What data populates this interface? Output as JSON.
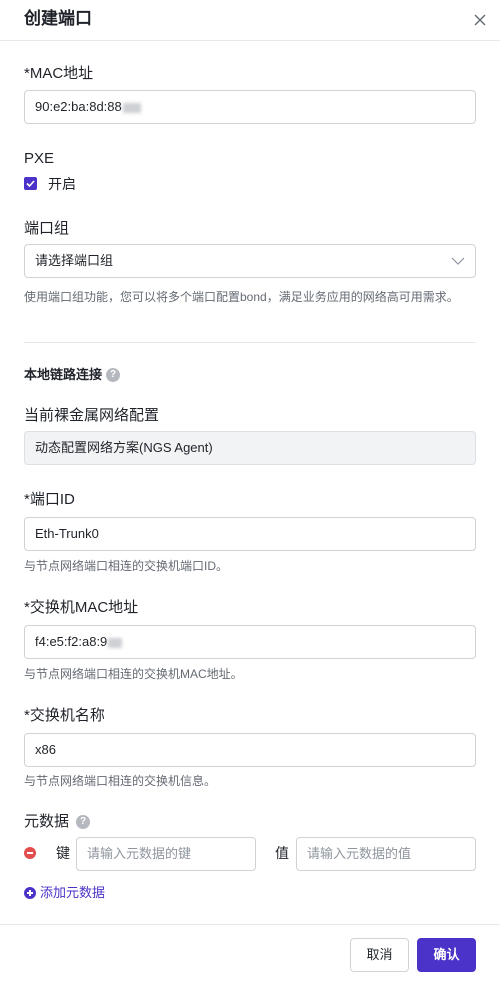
{
  "dialog": {
    "title": "创建端口"
  },
  "mac": {
    "label": "*MAC地址",
    "value": "90:e2:ba:8d:88"
  },
  "pxe": {
    "label": "PXE",
    "checkbox_label": "开启",
    "checked": true
  },
  "port_group": {
    "label": "端口组",
    "placeholder": "请选择端口组",
    "help": "使用端口组功能，您可以将多个端口配置bond，满足业务应用的网络高可用需求。"
  },
  "local_link": {
    "title": "本地链路连接"
  },
  "bare_metal": {
    "label": "当前裸金属网络配置",
    "value": "动态配置网络方案(NGS Agent)"
  },
  "port_id": {
    "label": "*端口ID",
    "value": "Eth-Trunk0",
    "help": "与节点网络端口相连的交换机端口ID。"
  },
  "switch_mac": {
    "label": "*交换机MAC地址",
    "value": "f4:e5:f2:a8:9",
    "help": "与节点网络端口相连的交换机MAC地址。"
  },
  "switch_name": {
    "label": "*交换机名称",
    "value": "x86",
    "help": "与节点网络端口相连的交换机信息。"
  },
  "metadata": {
    "label": "元数据",
    "key_label": "键",
    "key_placeholder": "请输入元数据的键",
    "value_label": "值",
    "value_placeholder": "请输入元数据的值",
    "add_label": "添加元数据"
  },
  "footer": {
    "cancel_label": "取消",
    "confirm_label": "确认"
  },
  "colors": {
    "accent": "#4b32c8",
    "danger": "#e24e4e",
    "border": "#d0d3d6"
  }
}
